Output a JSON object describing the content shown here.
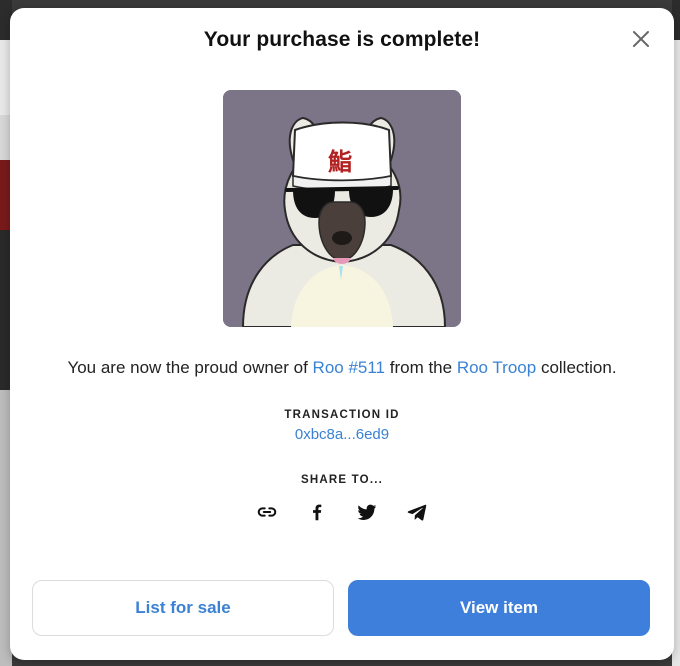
{
  "modal": {
    "title": "Your purchase is complete!",
    "close_icon": "close-icon"
  },
  "nft": {
    "image_desc": "nft-artwork",
    "hat_glyph": "鮨",
    "name": "Roo #511",
    "collection": "Roo Troop"
  },
  "message": {
    "prefix": "You are now the proud owner of ",
    "middle": " from the ",
    "suffix": " collection."
  },
  "transaction": {
    "label": "TRANSACTION ID",
    "id": "0xbc8a...6ed9"
  },
  "share": {
    "label": "SHARE TO...",
    "icons": [
      "link-icon",
      "facebook-icon",
      "twitter-icon",
      "telegram-icon"
    ]
  },
  "actions": {
    "list_label": "List for sale",
    "view_label": "View item"
  },
  "colors": {
    "accent": "#3b82d4",
    "primary_button": "#3f7fdc",
    "art_background": "#7c7487"
  }
}
